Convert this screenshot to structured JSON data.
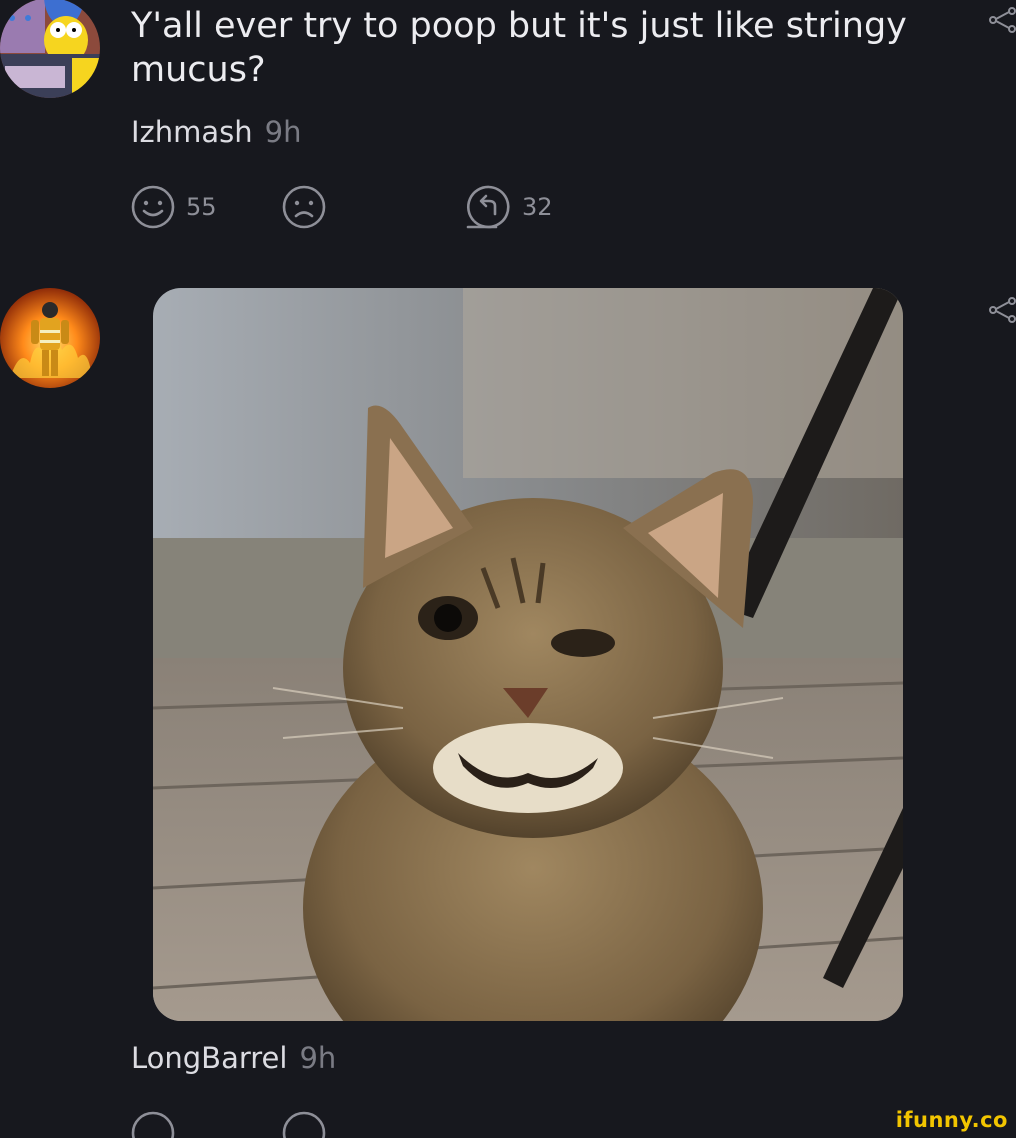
{
  "comments": [
    {
      "text": "Y'all ever try to poop but it's just like stringy mucus?",
      "username": "Izhmash",
      "time": "9h",
      "smile_count": "55",
      "reply_count": "32"
    },
    {
      "username": "LongBarrel",
      "time": "9h"
    }
  ],
  "watermark": "ifunny.co",
  "icons": {
    "smile": "smile-icon",
    "frown": "frown-icon",
    "reply": "reply-icon",
    "share": "share-icon"
  },
  "colors": {
    "background": "#17181e",
    "muted": "#7a7b84",
    "icon": "#8e8f98",
    "watermark": "#f2c500"
  }
}
